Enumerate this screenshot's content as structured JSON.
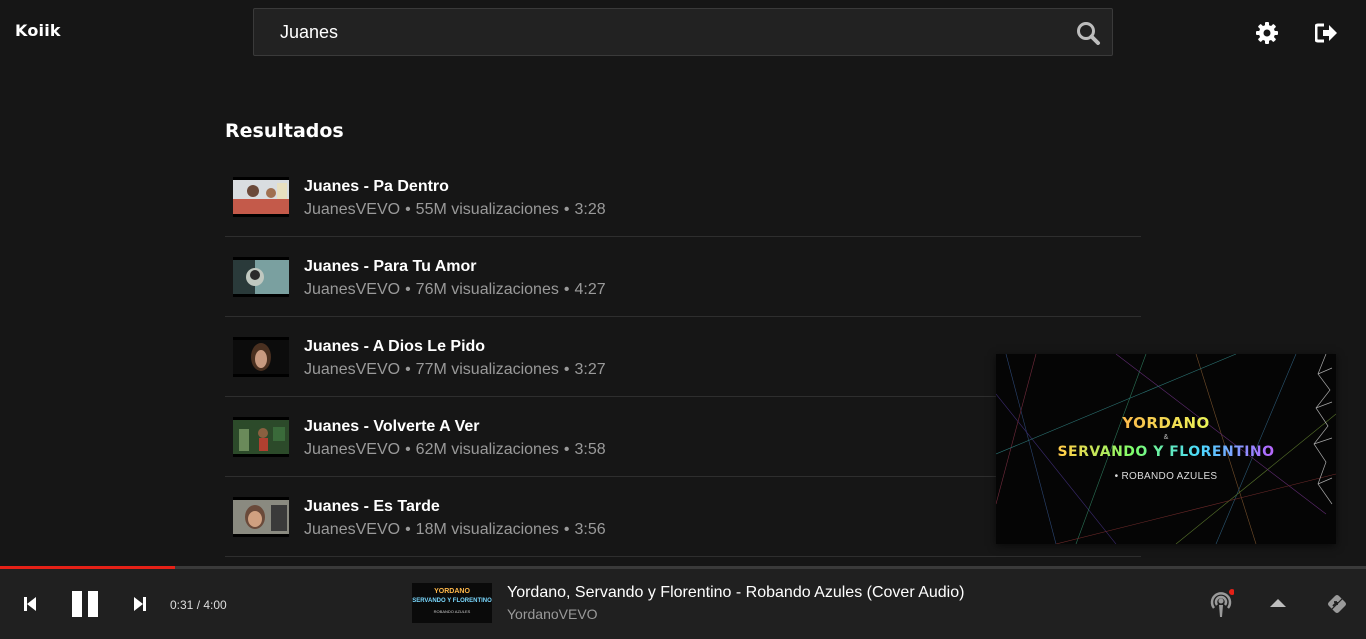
{
  "app": {
    "logo": "Koiik"
  },
  "search": {
    "value": "Juanes",
    "placeholder": ""
  },
  "results": {
    "title": "Resultados",
    "items": [
      {
        "title": "Juanes - Pa Dentro",
        "channel": "JuanesVEVO",
        "views": "55M visualizaciones",
        "duration": "3:28"
      },
      {
        "title": "Juanes - Para Tu Amor",
        "channel": "JuanesVEVO",
        "views": "76M visualizaciones",
        "duration": "4:27"
      },
      {
        "title": "Juanes - A Dios Le Pido",
        "channel": "JuanesVEVO",
        "views": "77M visualizaciones",
        "duration": "3:27"
      },
      {
        "title": "Juanes - Volverte A Ver",
        "channel": "JuanesVEVO",
        "views": "62M visualizaciones",
        "duration": "3:58"
      },
      {
        "title": "Juanes - Es Tarde",
        "channel": "JuanesVEVO",
        "views": "18M visualizaciones",
        "duration": "3:56"
      }
    ]
  },
  "separator": "•",
  "mini_player": {
    "line1": "YORDANO",
    "amp": "&",
    "line2": "SERVANDO Y FLORENTINO",
    "line3": "• ROBANDO AZULES"
  },
  "player": {
    "time": "0:31 / 4:00",
    "progress_fraction": 0.128,
    "now_playing_title": "Yordano, Servando y Florentino - Robando Azules (Cover Audio)",
    "now_playing_channel": "YordanoVEVO",
    "thumb_line1": "YORDANO",
    "thumb_line2": "SERVANDO Y FLORENTINO",
    "thumb_line3": "ROBANDO AZULES"
  },
  "colors": {
    "accent": "#e62117",
    "background": "#161616",
    "player_bg": "#202020",
    "notification_dot": "#e62117"
  },
  "icons": [
    "search-icon",
    "gear-icon",
    "sign-out-icon",
    "previous-icon",
    "pause-icon",
    "next-icon",
    "podcast-icon",
    "chevron-up-icon",
    "cast-icon"
  ]
}
